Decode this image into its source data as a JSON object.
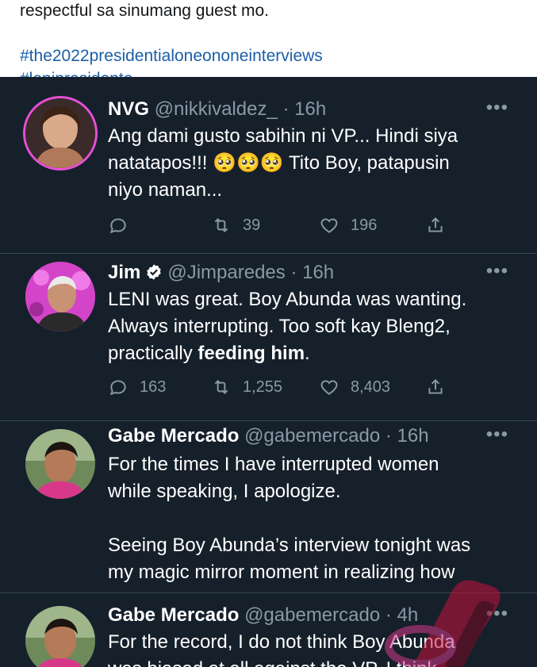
{
  "prev_tweet": {
    "line1": "respectful sa sinumang guest mo.",
    "hashtag1": "#the2022presidentialoneononeinterviews",
    "hashtag2": "#lenipresidente"
  },
  "tweets": [
    {
      "name": "NVG",
      "handle": "@nikkivaldez_",
      "time": "· 16h",
      "more": "•••",
      "text_lines": [
        "Ang dami gusto sabihin ni VP... Hindi siya",
        "natatapos!!! 🥺🥺🥺 Tito Boy, patapusin",
        "niyo naman..."
      ],
      "retweets": "39",
      "likes": "196"
    },
    {
      "name": "Jim",
      "handle": "@Jimparedes",
      "time": "· 16h",
      "more": "•••",
      "text_lines": [
        "LENI was great. Boy Abunda was wanting.",
        "Always interrupting. Too soft kay Bleng2,",
        "practically "
      ],
      "text_bold": "feeding him",
      "text_after": ".",
      "replies": "163",
      "retweets": "1,255",
      "likes": "8,403"
    },
    {
      "name": "Gabe Mercado",
      "handle": "@gabemercado",
      "time": "· 16h",
      "more": "•••",
      "text_lines": [
        "For the times I have interrupted women",
        "while speaking, I apologize.",
        "",
        "Seeing Boy Abunda’s interview tonight was",
        "my magic mirror moment in realizing how"
      ]
    },
    {
      "name": "Gabe Mercado",
      "handle": "@gabemercado",
      "time": "· 4h",
      "more": "•••",
      "text_lines": [
        "For the record, I do not think Boy Abunda",
        "was biased at all against the VP. I think"
      ]
    }
  ],
  "colors": {
    "background": "#15202b",
    "text": "#ffffff",
    "muted": "#8b98a5",
    "divider": "#38444d",
    "link": "#1b5fa7",
    "verified": "#ffffff"
  }
}
